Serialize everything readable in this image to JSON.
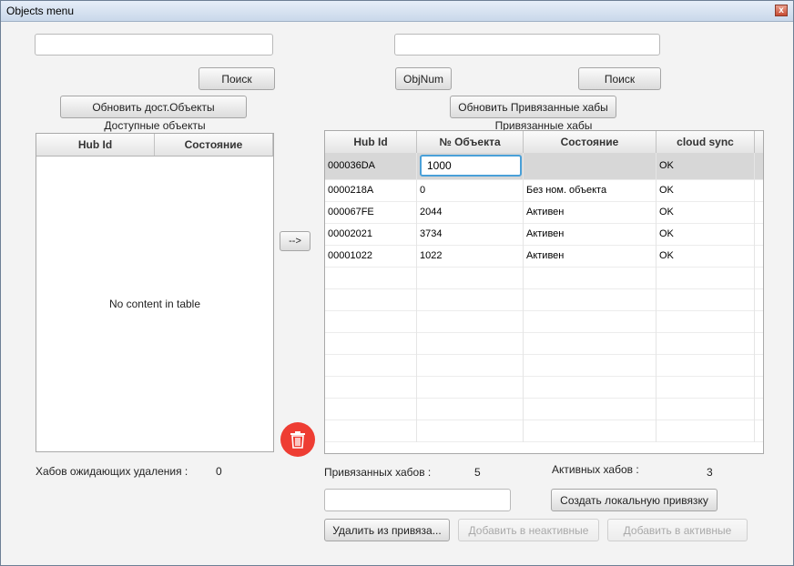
{
  "window": {
    "title": "Objects menu",
    "close_glyph": "x"
  },
  "left": {
    "search_value": "",
    "search_button": "Поиск",
    "refresh_button": "Обновить дост.Объекты",
    "section_label": "Доступные объекты",
    "columns": [
      "Hub Id",
      "Состояние"
    ],
    "empty_text": "No content in table",
    "pending_label": "Хабов ожидающих удаления :",
    "pending_count": "0"
  },
  "middle": {
    "transfer_button": "-->",
    "delete_icon": "trash-icon"
  },
  "right": {
    "search_value": "",
    "objnum_button": "ObjNum",
    "search_button": "Поиск",
    "refresh_button": "Обновить Привязанные хабы",
    "section_label": "Привязанные хабы",
    "columns": [
      "Hub Id",
      "№ Объекта",
      "Состояние",
      "cloud sync"
    ],
    "rows": [
      {
        "hub_id": "000036DA",
        "object": "1000",
        "state": "",
        "cloud": "OK",
        "editing": true
      },
      {
        "hub_id": "0000218A",
        "object": "0",
        "state": "Без ном. объекта",
        "cloud": "OK"
      },
      {
        "hub_id": "000067FE",
        "object": "2044",
        "state": "Активен",
        "cloud": "OK"
      },
      {
        "hub_id": "00002021",
        "object": "3734",
        "state": "Активен",
        "cloud": "OK"
      },
      {
        "hub_id": "00001022",
        "object": "1022",
        "state": "Активен",
        "cloud": "OK"
      }
    ],
    "linked_label": "Привязанных хабов :",
    "linked_count": "5",
    "active_label": "Активных хабов :",
    "active_count": "3",
    "local_input_value": "",
    "create_local_button": "Создать локальную привязку",
    "remove_button": "Удалить из привяза...",
    "add_inactive_button": "Добавить в неактивные",
    "add_active_button": "Добавить в активные"
  },
  "colors": {
    "delete_button": "#ee3d33",
    "edit_focus": "#4aa0d8",
    "selected_row": "#d7d7d7"
  }
}
